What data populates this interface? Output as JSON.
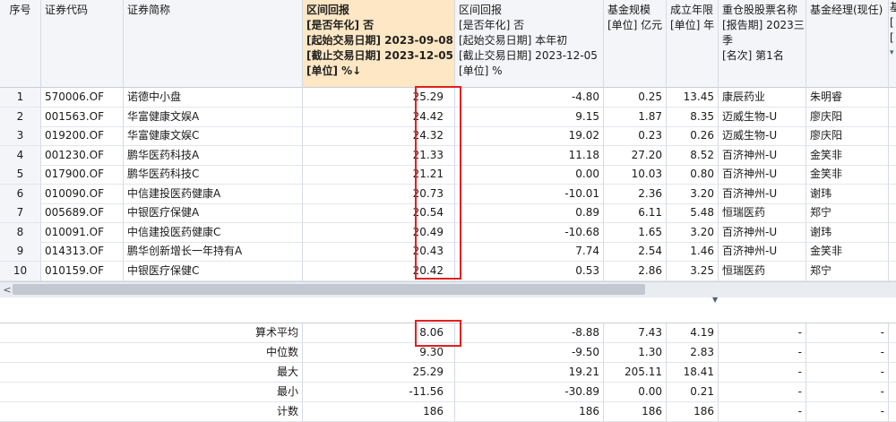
{
  "header": {
    "col_index": "序号",
    "col_code": "证券代码",
    "col_name": "证券简称",
    "col_ret1": [
      "区间回报",
      "[是否年化] 否",
      "[起始交易日期] 2023-09-08",
      "[截止交易日期] 2023-12-05",
      "[单位] %↓"
    ],
    "col_ret2": [
      "区间回报",
      "[是否年化] 否",
      "[起始交易日期] 本年初",
      "[截止交易日期] 2023-12-05",
      "[单位] %"
    ],
    "col_scale": [
      "基金规模",
      "[单位] 亿元"
    ],
    "col_age": [
      "成立年限",
      "[单位] 年"
    ],
    "col_stock": [
      "重仓股股票名称",
      "[报告期] 2023三",
      "季",
      "[名次] 第1名"
    ],
    "col_manager": "基金经理(现任)",
    "col_extra": [
      "基",
      "[",
      "[",
      "▾"
    ]
  },
  "rows": [
    {
      "idx": "1",
      "code": "570006.OF",
      "name": "诺德中小盘",
      "ret1": "25.29",
      "ret2": "-4.80",
      "scale": "0.25",
      "age": "13.45",
      "stock": "康辰药业",
      "manager": "朱明睿"
    },
    {
      "idx": "2",
      "code": "001563.OF",
      "name": "华富健康文娱A",
      "ret1": "24.42",
      "ret2": "9.15",
      "scale": "1.87",
      "age": "8.35",
      "stock": "迈威生物-U",
      "manager": "廖庆阳"
    },
    {
      "idx": "3",
      "code": "019200.OF",
      "name": "华富健康文娱C",
      "ret1": "24.32",
      "ret2": "19.02",
      "scale": "0.23",
      "age": "0.26",
      "stock": "迈威生物-U",
      "manager": "廖庆阳"
    },
    {
      "idx": "4",
      "code": "001230.OF",
      "name": "鹏华医药科技A",
      "ret1": "21.33",
      "ret2": "11.18",
      "scale": "27.20",
      "age": "8.52",
      "stock": "百济神州-U",
      "manager": "金笑非"
    },
    {
      "idx": "5",
      "code": "017900.OF",
      "name": "鹏华医药科技C",
      "ret1": "21.21",
      "ret2": "0.00",
      "scale": "10.03",
      "age": "0.80",
      "stock": "百济神州-U",
      "manager": "金笑非"
    },
    {
      "idx": "6",
      "code": "010090.OF",
      "name": "中信建投医药健康A",
      "ret1": "20.73",
      "ret2": "-10.01",
      "scale": "2.36",
      "age": "3.20",
      "stock": "百济神州-U",
      "manager": "谢玮"
    },
    {
      "idx": "7",
      "code": "005689.OF",
      "name": "中银医疗保健A",
      "ret1": "20.54",
      "ret2": "0.89",
      "scale": "6.11",
      "age": "5.48",
      "stock": "恒瑞医药",
      "manager": "郑宁"
    },
    {
      "idx": "8",
      "code": "010091.OF",
      "name": "中信建投医药健康C",
      "ret1": "20.49",
      "ret2": "-10.68",
      "scale": "1.65",
      "age": "3.20",
      "stock": "百济神州-U",
      "manager": "谢玮"
    },
    {
      "idx": "9",
      "code": "014313.OF",
      "name": "鹏华创新增长一年持有A",
      "ret1": "20.43",
      "ret2": "7.74",
      "scale": "2.54",
      "age": "1.46",
      "stock": "百济神州-U",
      "manager": "金笑非"
    },
    {
      "idx": "10",
      "code": "010159.OF",
      "name": "中银医疗保健C",
      "ret1": "20.42",
      "ret2": "0.53",
      "scale": "2.86",
      "age": "3.25",
      "stock": "恒瑞医药",
      "manager": "郑宁"
    }
  ],
  "summary": [
    {
      "label": "算术平均",
      "ret1": "8.06",
      "ret2": "-8.88",
      "scale": "7.43",
      "age": "4.19",
      "stock": "-",
      "manager": "-"
    },
    {
      "label": "中位数",
      "ret1": "9.30",
      "ret2": "-9.50",
      "scale": "1.30",
      "age": "2.83",
      "stock": "-",
      "manager": "-"
    },
    {
      "label": "最大",
      "ret1": "25.29",
      "ret2": "19.21",
      "scale": "205.11",
      "age": "18.41",
      "stock": "-",
      "manager": "-"
    },
    {
      "label": "最小",
      "ret1": "-11.56",
      "ret2": "-30.89",
      "scale": "0.00",
      "age": "0.21",
      "stock": "-",
      "manager": "-"
    },
    {
      "label": "计数",
      "ret1": "186",
      "ret2": "186",
      "scale": "186",
      "age": "186",
      "stock": "-",
      "manager": "-"
    }
  ],
  "scroll": {
    "left_arrow": "<",
    "split_arrow": "▼"
  },
  "colors": {
    "selected_header": "#fde7c4",
    "highlight_box": "#e02020",
    "header_bg": "#f3f5f8"
  }
}
